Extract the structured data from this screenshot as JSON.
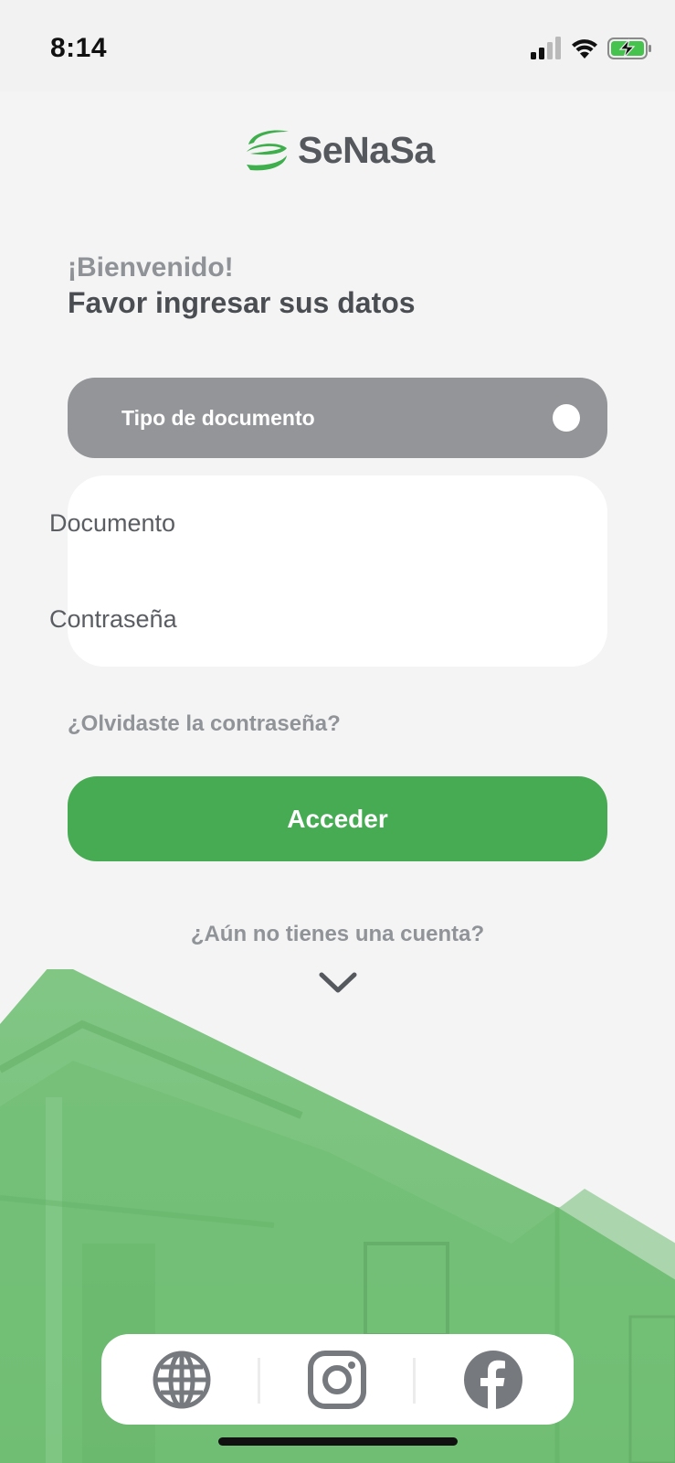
{
  "status_bar": {
    "time": "8:14",
    "icons": [
      "cellular-signal-icon",
      "wifi-icon",
      "battery-charging-icon"
    ]
  },
  "brand": {
    "name": "SeNaSa",
    "accent_color": "#46ab53",
    "logo_icon": "senasa-logo-mark-icon"
  },
  "header": {
    "welcome": "¡Bienvenido!",
    "subtitle": "Favor ingresar sus datos"
  },
  "form": {
    "document_type_label": "Tipo de documento",
    "document_placeholder": "Documento",
    "password_placeholder": "Contraseña",
    "forgot_password": "¿Olvidaste la contraseña?",
    "submit_label": "Acceder"
  },
  "signup": {
    "prompt": "¿Aún no tienes una cuenta?",
    "expand_icon": "chevron-down-icon"
  },
  "social": {
    "items": [
      {
        "icon": "globe-icon",
        "name": "web"
      },
      {
        "icon": "instagram-icon",
        "name": "instagram"
      },
      {
        "icon": "facebook-icon",
        "name": "facebook"
      }
    ]
  },
  "colors": {
    "background": "#f4f4f4",
    "select_background": "#939598",
    "button_green": "#46ab53",
    "muted_text": "#909398",
    "dark_text": "#4a4d52"
  }
}
